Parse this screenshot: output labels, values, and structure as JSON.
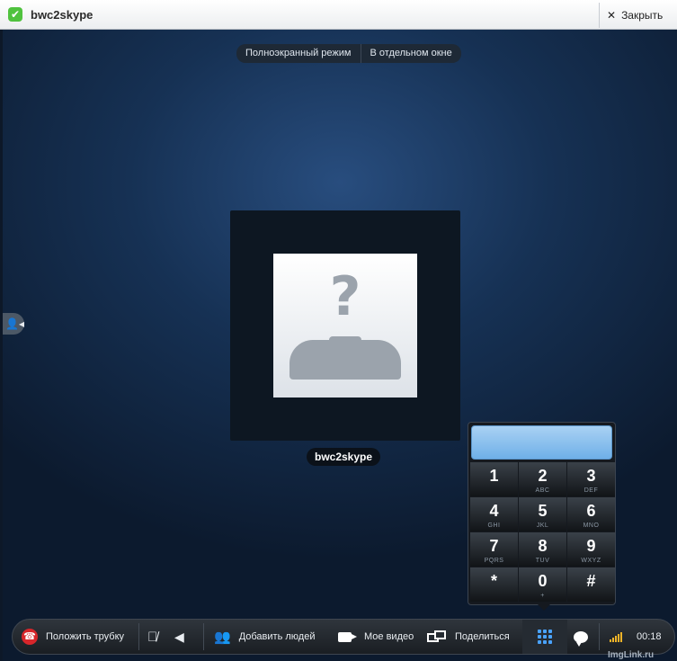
{
  "window": {
    "title": "bwc2skype",
    "close_label": "Закрыть",
    "close_icon": "close-icon",
    "app_icon": "skype-check-icon"
  },
  "view_toggle": {
    "fullscreen_label": "Полноэкранный режим",
    "separate_window_label": "В отдельном окне"
  },
  "side_tab": {
    "icon": "contact-panel-icon"
  },
  "call": {
    "caller_name": "bwc2skype",
    "avatar_icon": "unknown-user-avatar-icon"
  },
  "dialpad": {
    "display_value": "",
    "keys": [
      {
        "digit": "1",
        "letters": ""
      },
      {
        "digit": "2",
        "letters": "ABC"
      },
      {
        "digit": "3",
        "letters": "DEF"
      },
      {
        "digit": "4",
        "letters": "GHI"
      },
      {
        "digit": "5",
        "letters": "JKL"
      },
      {
        "digit": "6",
        "letters": "MNO"
      },
      {
        "digit": "7",
        "letters": "PQRS"
      },
      {
        "digit": "8",
        "letters": "TUV"
      },
      {
        "digit": "9",
        "letters": "WXYZ"
      },
      {
        "digit": "*",
        "letters": ""
      },
      {
        "digit": "0",
        "letters": "+"
      },
      {
        "digit": "#",
        "letters": ""
      }
    ]
  },
  "toolbar": {
    "hangup_label": "Положить трубку",
    "mute_icon": "microphone-muted-icon",
    "volume_icon": "speaker-icon",
    "add_people_label": "Добавить людей",
    "my_video_label": "Мое видео",
    "share_label": "Поделиться",
    "dialpad_icon": "dialpad-grid-icon",
    "chat_icon": "chat-bubble-icon",
    "signal_icon": "call-quality-signal-icon",
    "call_duration": "00:18"
  },
  "watermark": "ImgLink.ru",
  "colors": {
    "hangup": "#d7262b",
    "accent": "#4aa3ff",
    "signal": "#f2b428",
    "app_green": "#4fc23e"
  }
}
